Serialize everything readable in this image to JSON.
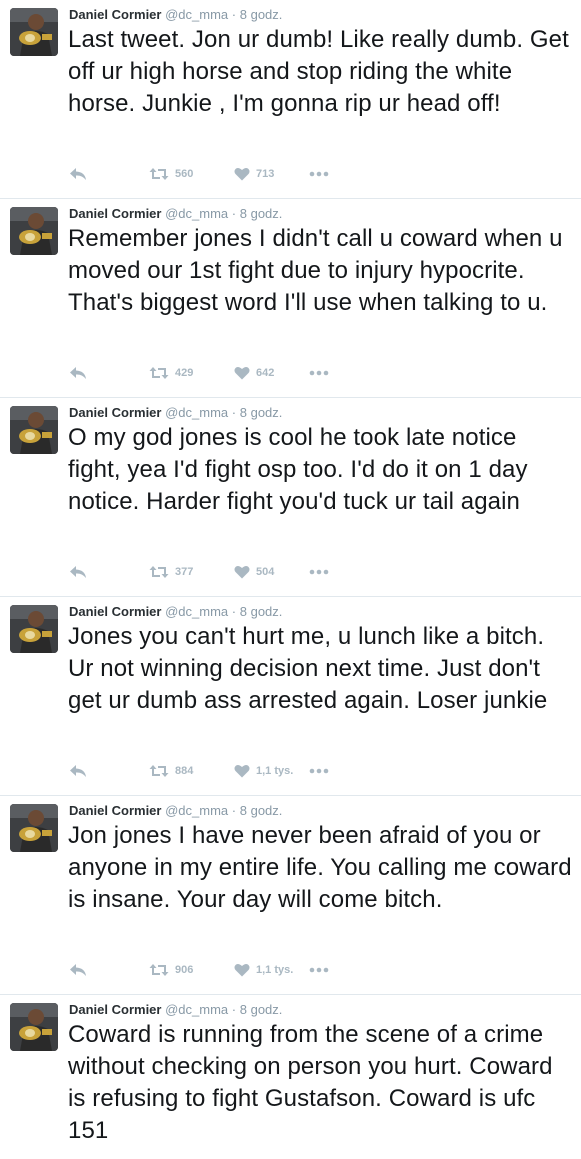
{
  "colors": {
    "text": "#14171a",
    "muted": "#8899a6",
    "icon": "#aab8c2",
    "divider": "#e1e8ed"
  },
  "tweets": [
    {
      "name": "Daniel Cormier",
      "handle": "@dc_mma",
      "dot": "·",
      "time": "8 godz.",
      "text": "Last tweet. Jon ur dumb! Like really dumb. Get off ur high horse and stop riding the white horse. Junkie , I'm gonna rip ur head off!",
      "retweets": "560",
      "likes": "713",
      "icons": [
        "reply-icon",
        "retweet-icon",
        "heart-icon",
        "more-icon"
      ]
    },
    {
      "name": "Daniel Cormier",
      "handle": "@dc_mma",
      "dot": "·",
      "time": "8 godz.",
      "text": "Remember jones I didn't call u coward when u moved our 1st fight due to injury hypocrite. That's biggest word I'll use when talking to u.",
      "retweets": "429",
      "likes": "642",
      "icons": [
        "reply-icon",
        "retweet-icon",
        "heart-icon",
        "more-icon"
      ]
    },
    {
      "name": "Daniel Cormier",
      "handle": "@dc_mma",
      "dot": "·",
      "time": "8 godz.",
      "text": "O my god  jones is cool he took late notice fight, yea I'd fight osp too. I'd do it on 1 day notice. Harder fight you'd tuck ur tail again",
      "retweets": "377",
      "likes": "504",
      "icons": [
        "reply-icon",
        "retweet-icon",
        "heart-icon",
        "more-icon"
      ]
    },
    {
      "name": "Daniel Cormier",
      "handle": "@dc_mma",
      "dot": "·",
      "time": "8 godz.",
      "text": "Jones you can't hurt me, u lunch like a bitch. Ur not winning decision next time. Just don't get ur dumb ass arrested again.  Loser junkie",
      "retweets": "884",
      "likes": "1,1 tys.",
      "icons": [
        "reply-icon",
        "retweet-icon",
        "heart-icon",
        "more-icon"
      ]
    },
    {
      "name": "Daniel Cormier",
      "handle": "@dc_mma",
      "dot": "·",
      "time": "8 godz.",
      "text": "Jon jones I have never been afraid of you or anyone in my entire life.  You calling me coward is insane. Your day will come bitch.",
      "retweets": "906",
      "likes": "1,1 tys.",
      "icons": [
        "reply-icon",
        "retweet-icon",
        "heart-icon",
        "more-icon"
      ]
    },
    {
      "name": "Daniel Cormier",
      "handle": "@dc_mma",
      "dot": "·",
      "time": "8 godz.",
      "text": "Coward is running from the scene of a crime without checking on person you hurt.  Coward is refusing to fight Gustafson. Coward is ufc 151",
      "retweets": "",
      "likes": "",
      "icons": []
    }
  ]
}
